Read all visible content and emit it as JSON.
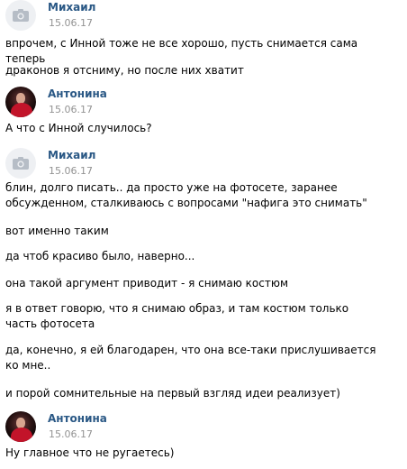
{
  "messages": [
    {
      "author": "Михаил",
      "date": "15.06.17",
      "avatar": "camera-icon",
      "lines": [
        "впрочем, с Инной тоже не все хорошо, пусть снимается сама теперь",
        "драконов я отсниму, но после них хватит"
      ]
    },
    {
      "author": "Антонина",
      "date": "15.06.17",
      "avatar": "photo",
      "lines": [
        "А что с Инной случилось?"
      ]
    },
    {
      "author": "Михаил",
      "date": "15.06.17",
      "avatar": "camera-icon",
      "lines": [
        "блин, долго писать.. да просто уже на фотосете, заранее обсужденном, сталкиваюсь с вопросами \"нафига это снимать\"",
        "вот именно таким",
        "да чтоб красиво было, наверно...",
        "она такой аргумент приводит - я снимаю костюм",
        "я в ответ говорю, что я снимаю образ, и там костюм только часть фотосета",
        "да, конечно, я ей благодарен, что она все-таки прислушивается ко мне..",
        "и порой сомнительные на первый взгляд идеи реализует)"
      ]
    },
    {
      "author": "Антонина",
      "date": "15.06.17",
      "avatar": "photo",
      "lines": [
        "Ну главное что не ругаетесь)"
      ]
    }
  ],
  "colors": {
    "author_name": "#2a5885",
    "date": "#939393",
    "text": "#000000"
  }
}
